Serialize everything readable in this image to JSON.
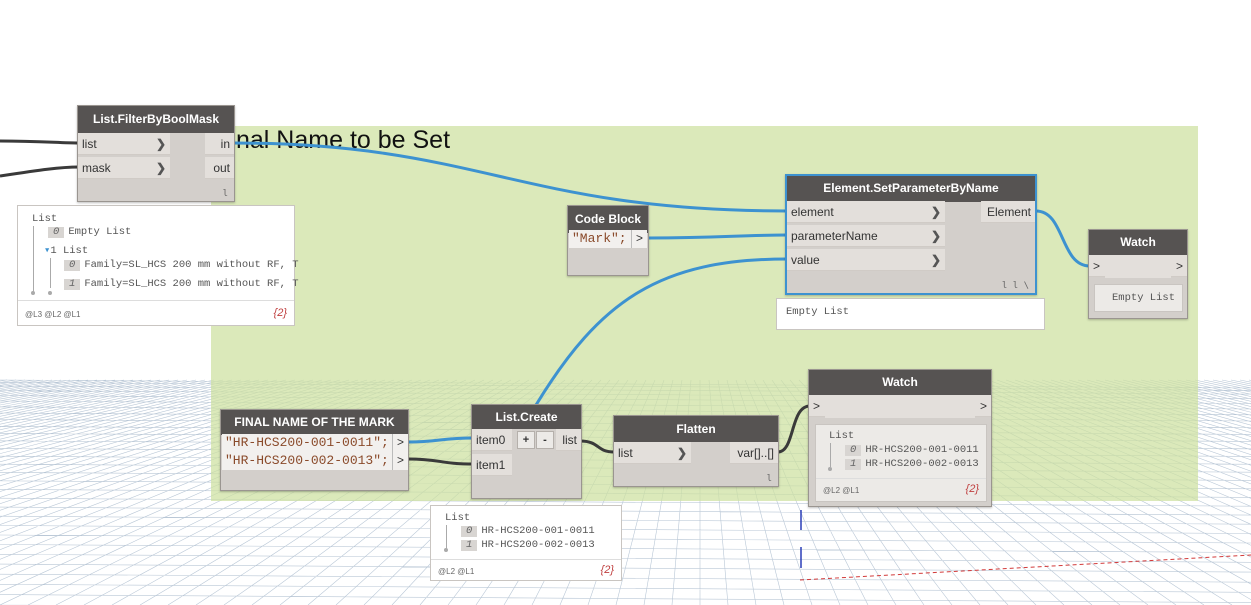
{
  "group": {
    "title": "nal Name to be Set",
    "background": "#cde1a0"
  },
  "colors": {
    "node_header": "#565352",
    "node_body": "#d3cfcb",
    "wire_blue": "#3d92d0",
    "wire_dark": "#3a3a3a",
    "string_literal": "#8a4a2a",
    "count_red": "#c04040"
  },
  "filter_node": {
    "title": "List.FilterByBoolMask",
    "inputs": [
      "list",
      "mask"
    ],
    "outputs": [
      "in",
      "out"
    ],
    "lacing": "l",
    "chevron": "❯"
  },
  "filter_watch": {
    "root": "List",
    "items": [
      {
        "idx": "0",
        "text": "Empty List"
      },
      {
        "idx": "1",
        "text": "List"
      },
      {
        "idx": "0",
        "text": "Family=SL_HCS 200 mm without RF, T"
      },
      {
        "idx": "1",
        "text": "Family=SL_HCS 200 mm without RF, T"
      }
    ],
    "levels": "@L3 @L2 @L1",
    "count": "{2}"
  },
  "code_block": {
    "title": "Code Block",
    "line": "\"Mark\";",
    "out": ">"
  },
  "set_param_node": {
    "title": "Element.SetParameterByName",
    "inputs": [
      "element",
      "parameterName",
      "value"
    ],
    "outputs": [
      "Element"
    ],
    "lacing": "l l \\",
    "preview": "Empty List"
  },
  "watch_top": {
    "title": "Watch",
    "in": ">",
    "out": ">",
    "content": "Empty List"
  },
  "final_name_node": {
    "title": "FINAL NAME OF THE MARK",
    "lines": [
      "\"HR-HCS200-001-0011\";",
      "\"HR-HCS200-002-0013\";"
    ],
    "port": ">"
  },
  "list_create": {
    "title": "List.Create",
    "inputs": [
      "item0",
      "item1"
    ],
    "plus": "+",
    "minus": "-",
    "output": "list",
    "preview": {
      "root": "List",
      "items": [
        {
          "idx": "0",
          "text": "HR-HCS200-001-0011"
        },
        {
          "idx": "1",
          "text": "HR-HCS200-002-0013"
        }
      ],
      "levels": "@L2 @L1",
      "count": "{2}"
    }
  },
  "flatten": {
    "title": "Flatten",
    "input": "list",
    "output": "var[]..[]",
    "lacing": "l"
  },
  "watch_bottom": {
    "title": "Watch",
    "in": ">",
    "out": ">",
    "root": "List",
    "items": [
      {
        "idx": "0",
        "text": "HR-HCS200-001-0011"
      },
      {
        "idx": "1",
        "text": "HR-HCS200-002-0013"
      }
    ],
    "levels": "@L2 @L1",
    "count": "{2}"
  }
}
